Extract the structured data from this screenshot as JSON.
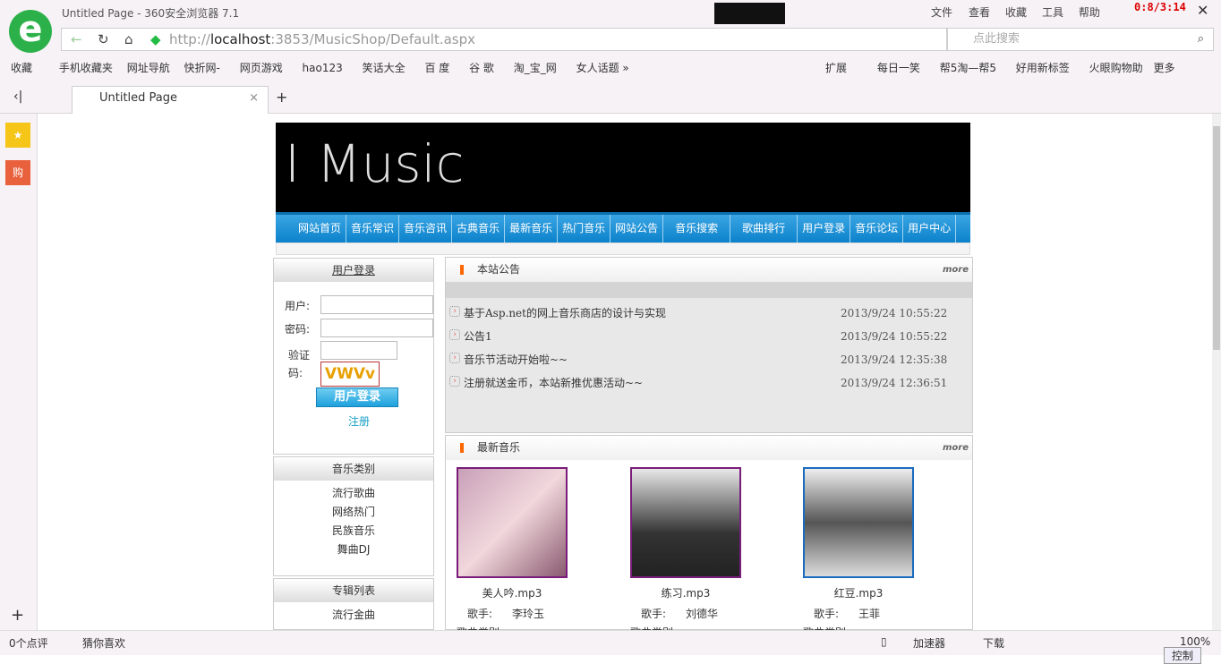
{
  "browser": {
    "title": "Untitled Page - 360安全浏览器 7.1",
    "url_prefix": "http://",
    "url_host": "localhost",
    "url_rest": ":3853/MusicShop/Default.aspx",
    "search_placeholder": "点此搜索",
    "menus": [
      "文件",
      "查看",
      "收藏",
      "工具",
      "帮助"
    ],
    "clock": "0:8/3:14",
    "bookmarks": [
      "收藏",
      "手机收藏夹",
      "网址导航",
      "快折网-",
      "网页游戏",
      "hao123",
      "笑话大全",
      "百 度",
      "谷 歌",
      "淘_宝_网",
      "女人话题"
    ],
    "bookmarks_right": [
      "扩展",
      "每日一笑",
      "帮5淘—帮5",
      "好用新标签",
      "火眼购物助",
      "更多"
    ],
    "tab": "Untitled Page",
    "status": [
      "0个点评",
      "猜你喜欢",
      "加速器",
      "下载",
      "100%"
    ],
    "control": "控制"
  },
  "site": {
    "logo": "I Music",
    "nav": [
      "网站首页",
      "音乐常识",
      "音乐咨讯",
      "古典音乐",
      "最新音乐",
      "热门音乐",
      "网站公告",
      "音乐搜索",
      "歌曲排行",
      "用户登录",
      "音乐论坛",
      "用户中心"
    ],
    "login": {
      "title": "用户登录",
      "user_label": "用户:",
      "pass_label": "密码:",
      "code_label": "验证码:",
      "captcha": "VWVv",
      "button": "用户登录",
      "register": "注册"
    },
    "categories": {
      "title": "音乐类别",
      "items": [
        "流行歌曲",
        "网络热门",
        "民族音乐",
        "舞曲DJ"
      ]
    },
    "albums": {
      "title": "专辑列表",
      "items": [
        "流行金曲"
      ]
    },
    "notices": {
      "title": "本站公告",
      "more": "more",
      "items": [
        {
          "text": "基于Asp.net的网上音乐商店的设计与实现",
          "date": "2013/9/24 10:55:22"
        },
        {
          "text": "公告1",
          "date": "2013/9/24 10:55:22"
        },
        {
          "text": "音乐节活动开始啦~~",
          "date": "2013/9/24 12:35:38"
        },
        {
          "text": "注册就送金币，本站新推优惠活动~~",
          "date": "2013/9/24 12:36:51"
        }
      ]
    },
    "new_music": {
      "title": "最新音乐",
      "more": "more",
      "singer_label": "歌手:",
      "category_label": "歌曲类别:",
      "songs": [
        {
          "name": "美人吟.mp3",
          "singer": "李玲玉",
          "border": "#7a1d7a"
        },
        {
          "name": "练习.mp3",
          "singer": "刘德华",
          "border": "#7a1d7a"
        },
        {
          "name": "红豆.mp3",
          "singer": "王菲",
          "border": "#1a6bbf"
        }
      ]
    }
  }
}
